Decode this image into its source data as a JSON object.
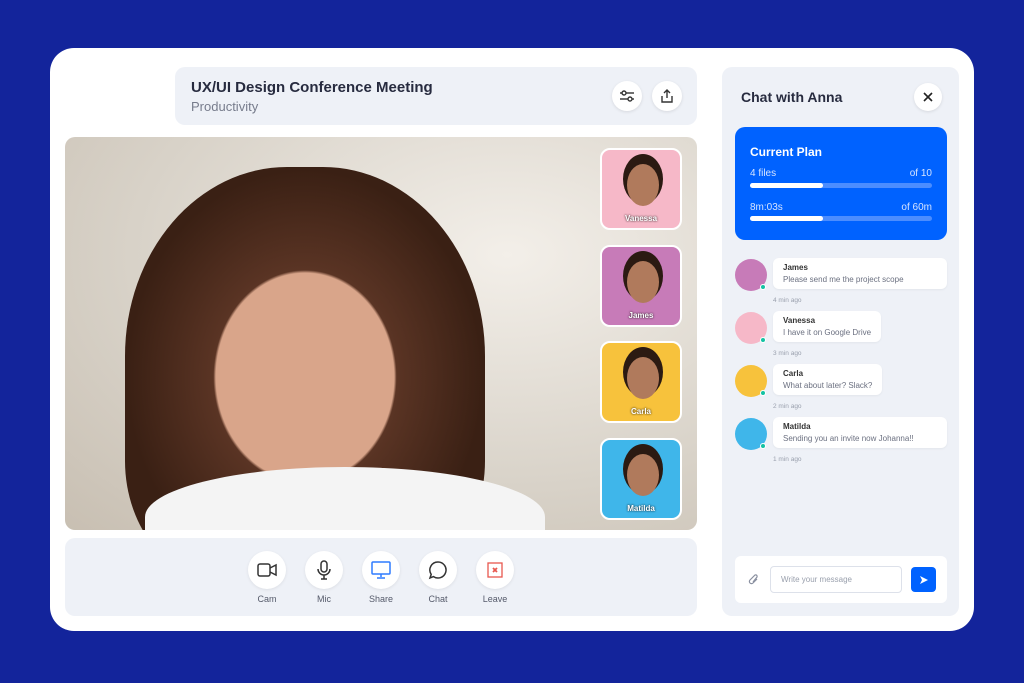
{
  "header": {
    "title": "UX/UI Design Conference Meeting",
    "subtitle": "Productivity"
  },
  "participants": [
    {
      "name": "Vanessa",
      "bg": "#f6b8c8"
    },
    {
      "name": "James",
      "bg": "#c77bb8"
    },
    {
      "name": "Carla",
      "bg": "#f7c23c"
    },
    {
      "name": "Matilda",
      "bg": "#3fb6ea"
    }
  ],
  "controls": [
    {
      "label": "Cam",
      "icon": "camera-icon"
    },
    {
      "label": "Mic",
      "icon": "mic-icon"
    },
    {
      "label": "Share",
      "icon": "monitor-icon"
    },
    {
      "label": "Chat",
      "icon": "chat-bubble-icon"
    },
    {
      "label": "Leave",
      "icon": "leave-icon"
    }
  ],
  "chat": {
    "title": "Chat with Anna",
    "plan": {
      "title": "Current Plan",
      "files_label": "4 files",
      "files_total": "of 10",
      "files_progress": 0.4,
      "time_label": "8m:03s",
      "time_total": "of 60m",
      "time_progress": 0.4
    },
    "messages": [
      {
        "author": "James",
        "text": "Please send me the project scope",
        "time": "4 min ago"
      },
      {
        "author": "Vanessa",
        "text": "I have it on Google Drive",
        "time": "3 min ago"
      },
      {
        "author": "Carla",
        "text": "What about later? Slack?",
        "time": "2 min ago"
      },
      {
        "author": "Matilda",
        "text": "Sending you an invite now Johanna!!",
        "time": "1 min ago"
      }
    ],
    "input_placeholder": "Write your message"
  },
  "colors": {
    "background": "#13249b",
    "accent": "#0062ff",
    "online": "#14c2a3",
    "leave": "#e8584f"
  }
}
